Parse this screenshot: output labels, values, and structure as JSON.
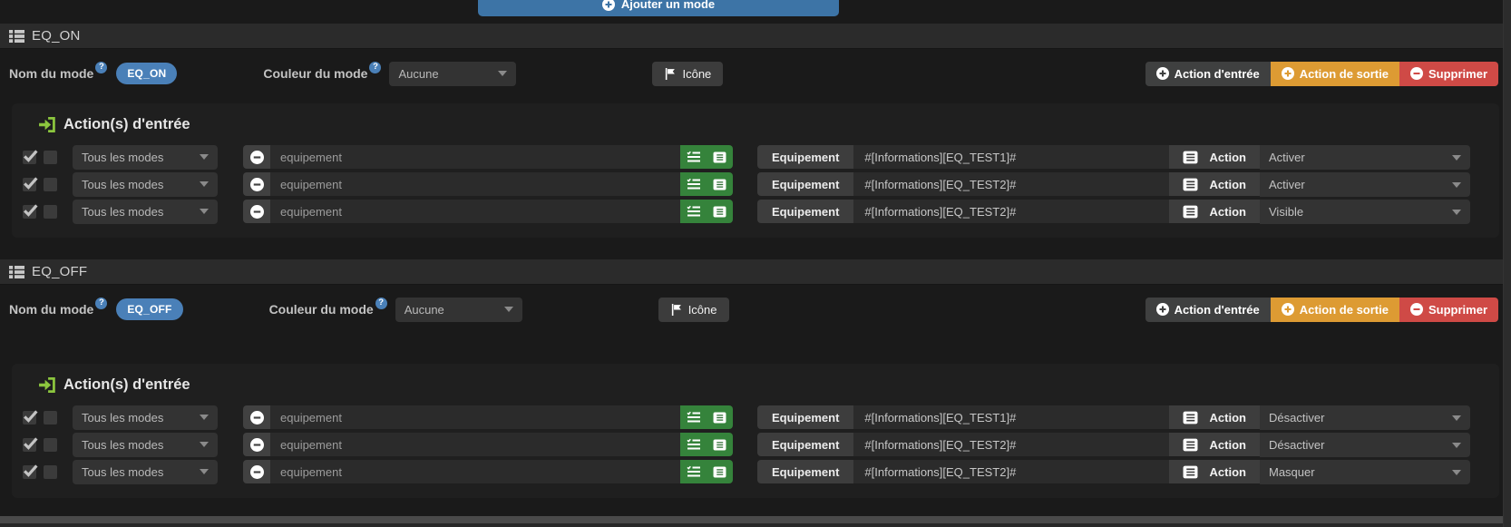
{
  "toolbar": {
    "add_mode_label": "Ajouter un mode"
  },
  "labels": {
    "mode_name": "Nom du mode",
    "mode_color": "Couleur du mode",
    "icon_button": "Icône",
    "entry_action_button": "Action d'entrée",
    "exit_action_button": "Action de sortie",
    "delete_button": "Supprimer",
    "entry_actions_heading": "Action(s) d'entrée",
    "equipment_addon": "Equipement",
    "action_addon": "Action",
    "equipment_placeholder": "equipement"
  },
  "colors": {
    "blue": "#3d74a6",
    "badge_blue": "#4a80b8",
    "orange": "#dd9b33",
    "red": "#cf4a46",
    "green": "#35833b",
    "icon_green": "#8cc63e"
  },
  "sections": [
    {
      "title": "EQ_ON",
      "mode_name": "EQ_ON",
      "color_value": "Aucune",
      "rows": [
        {
          "scope": "Tous les modes",
          "command": "#[Informations][EQ_TEST1]#",
          "action": "Activer"
        },
        {
          "scope": "Tous les modes",
          "command": "#[Informations][EQ_TEST2]#",
          "action": "Activer"
        },
        {
          "scope": "Tous les modes",
          "command": "#[Informations][EQ_TEST2]#",
          "action": "Visible"
        }
      ]
    },
    {
      "title": "EQ_OFF",
      "mode_name": "EQ_OFF",
      "color_value": "Aucune",
      "rows": [
        {
          "scope": "Tous les modes",
          "command": "#[Informations][EQ_TEST1]#",
          "action": "Désactiver"
        },
        {
          "scope": "Tous les modes",
          "command": "#[Informations][EQ_TEST2]#",
          "action": "Désactiver"
        },
        {
          "scope": "Tous les modes",
          "command": "#[Informations][EQ_TEST2]#",
          "action": "Masquer"
        }
      ]
    }
  ]
}
